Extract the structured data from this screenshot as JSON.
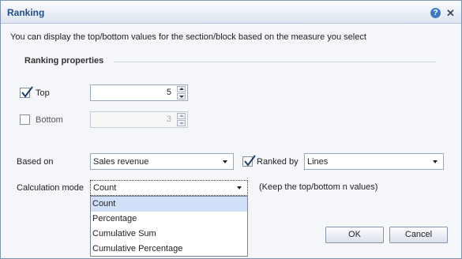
{
  "dialog": {
    "title": "Ranking",
    "description": "You can display the top/bottom values for the section/block based on the measure you select"
  },
  "ranking_properties": {
    "section_title": "Ranking properties",
    "top": {
      "label": "Top",
      "checked": true,
      "value": "5"
    },
    "bottom": {
      "label": "Bottom",
      "checked": false,
      "value": "3"
    }
  },
  "based_on": {
    "label": "Based on",
    "selected": "Sales revenue"
  },
  "ranked_by": {
    "label": "Ranked by",
    "checked": true,
    "selected": "Lines"
  },
  "calculation_mode": {
    "label": "Calculation mode",
    "selected": "Count",
    "hint": "(Keep the top/bottom n values)",
    "options": [
      "Count",
      "Percentage",
      "Cumulative Sum",
      "Cumulative Percentage"
    ]
  },
  "buttons": {
    "ok": "OK",
    "cancel": "Cancel"
  },
  "icons": {
    "help": "help-icon",
    "close": "close-icon"
  },
  "colors": {
    "title": "#1f4e8c",
    "selected_option": "#cfe0f8"
  }
}
